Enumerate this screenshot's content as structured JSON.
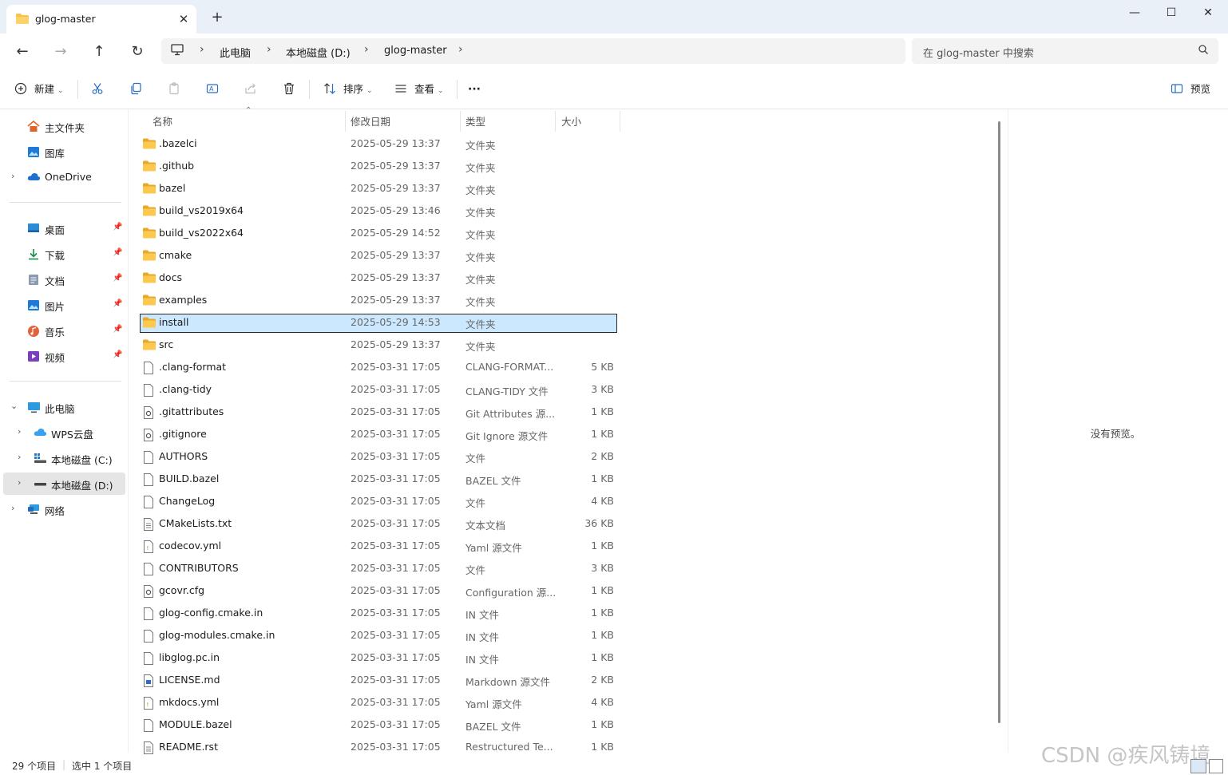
{
  "window": {
    "tab_title": "glog-master",
    "tab_close": "✕",
    "new_tab": "+",
    "minimize": "—",
    "maximize": "☐",
    "close": "✕"
  },
  "nav": {
    "back": "←",
    "forward": "→",
    "up": "↑",
    "refresh": "↻",
    "breadcrumb": [
      "此电脑",
      "本地磁盘 (D:)",
      "glog-master"
    ],
    "search_placeholder": "在 glog-master 中搜索"
  },
  "toolbar": {
    "new_label": "新建",
    "sort_label": "排序",
    "view_label": "查看",
    "more_label": "···",
    "preview_label": "预览"
  },
  "sidebar": {
    "items": [
      {
        "label": "主文件夹",
        "icon": "home-icon"
      },
      {
        "label": "图库",
        "icon": "gallery-icon"
      },
      {
        "label": "OneDrive",
        "icon": "cloud-icon"
      },
      {
        "label": "桌面",
        "icon": "desktop-icon"
      },
      {
        "label": "下载",
        "icon": "download-icon"
      },
      {
        "label": "文档",
        "icon": "document-icon"
      },
      {
        "label": "图片",
        "icon": "pictures-icon"
      },
      {
        "label": "音乐",
        "icon": "music-icon"
      },
      {
        "label": "视频",
        "icon": "video-icon"
      },
      {
        "label": "此电脑",
        "icon": "computer-icon"
      },
      {
        "label": "WPS云盘",
        "icon": "wps-cloud-icon"
      },
      {
        "label": "本地磁盘 (C:)",
        "icon": "drive-icon"
      },
      {
        "label": "本地磁盘 (D:)",
        "icon": "drive-icon"
      },
      {
        "label": "网络",
        "icon": "network-icon"
      }
    ]
  },
  "columns": {
    "name": "名称",
    "date": "修改日期",
    "type": "类型",
    "size": "大小"
  },
  "files": [
    {
      "name": ".bazelci",
      "date": "2025-05-29 13:37",
      "type": "文件夹",
      "size": "",
      "kind": "folder"
    },
    {
      "name": ".github",
      "date": "2025-05-29 13:37",
      "type": "文件夹",
      "size": "",
      "kind": "folder"
    },
    {
      "name": "bazel",
      "date": "2025-05-29 13:37",
      "type": "文件夹",
      "size": "",
      "kind": "folder"
    },
    {
      "name": "build_vs2019x64",
      "date": "2025-05-29 13:46",
      "type": "文件夹",
      "size": "",
      "kind": "folder"
    },
    {
      "name": "build_vs2022x64",
      "date": "2025-05-29 14:52",
      "type": "文件夹",
      "size": "",
      "kind": "folder"
    },
    {
      "name": "cmake",
      "date": "2025-05-29 13:37",
      "type": "文件夹",
      "size": "",
      "kind": "folder"
    },
    {
      "name": "docs",
      "date": "2025-05-29 13:37",
      "type": "文件夹",
      "size": "",
      "kind": "folder"
    },
    {
      "name": "examples",
      "date": "2025-05-29 13:37",
      "type": "文件夹",
      "size": "",
      "kind": "folder"
    },
    {
      "name": "install",
      "date": "2025-05-29 14:53",
      "type": "文件夹",
      "size": "",
      "kind": "folder",
      "selected": true
    },
    {
      "name": "src",
      "date": "2025-05-29 13:37",
      "type": "文件夹",
      "size": "",
      "kind": "folder"
    },
    {
      "name": ".clang-format",
      "date": "2025-03-31 17:05",
      "type": "CLANG-FORMAT...",
      "size": "5 KB",
      "kind": "file"
    },
    {
      "name": ".clang-tidy",
      "date": "2025-03-31 17:05",
      "type": "CLANG-TIDY 文件",
      "size": "3 KB",
      "kind": "file"
    },
    {
      "name": ".gitattributes",
      "date": "2025-03-31 17:05",
      "type": "Git Attributes 源...",
      "size": "1 KB",
      "kind": "config"
    },
    {
      "name": ".gitignore",
      "date": "2025-03-31 17:05",
      "type": "Git Ignore 源文件",
      "size": "1 KB",
      "kind": "config"
    },
    {
      "name": "AUTHORS",
      "date": "2025-03-31 17:05",
      "type": "文件",
      "size": "2 KB",
      "kind": "file"
    },
    {
      "name": "BUILD.bazel",
      "date": "2025-03-31 17:05",
      "type": "BAZEL 文件",
      "size": "1 KB",
      "kind": "file"
    },
    {
      "name": "ChangeLog",
      "date": "2025-03-31 17:05",
      "type": "文件",
      "size": "4 KB",
      "kind": "file"
    },
    {
      "name": "CMakeLists.txt",
      "date": "2025-03-31 17:05",
      "type": "文本文档",
      "size": "36 KB",
      "kind": "text"
    },
    {
      "name": "codecov.yml",
      "date": "2025-03-31 17:05",
      "type": "Yaml 源文件",
      "size": "1 KB",
      "kind": "yaml"
    },
    {
      "name": "CONTRIBUTORS",
      "date": "2025-03-31 17:05",
      "type": "文件",
      "size": "3 KB",
      "kind": "file"
    },
    {
      "name": "gcovr.cfg",
      "date": "2025-03-31 17:05",
      "type": "Configuration 源...",
      "size": "1 KB",
      "kind": "config"
    },
    {
      "name": "glog-config.cmake.in",
      "date": "2025-03-31 17:05",
      "type": "IN 文件",
      "size": "1 KB",
      "kind": "file"
    },
    {
      "name": "glog-modules.cmake.in",
      "date": "2025-03-31 17:05",
      "type": "IN 文件",
      "size": "1 KB",
      "kind": "file"
    },
    {
      "name": "libglog.pc.in",
      "date": "2025-03-31 17:05",
      "type": "IN 文件",
      "size": "1 KB",
      "kind": "file"
    },
    {
      "name": "LICENSE.md",
      "date": "2025-03-31 17:05",
      "type": "Markdown 源文件",
      "size": "2 KB",
      "kind": "markdown"
    },
    {
      "name": "mkdocs.yml",
      "date": "2025-03-31 17:05",
      "type": "Yaml 源文件",
      "size": "4 KB",
      "kind": "yaml"
    },
    {
      "name": "MODULE.bazel",
      "date": "2025-03-31 17:05",
      "type": "BAZEL 文件",
      "size": "1 KB",
      "kind": "file"
    },
    {
      "name": "README.rst",
      "date": "2025-03-31 17:05",
      "type": "Restructured Te...",
      "size": "1 KB",
      "kind": "text"
    }
  ],
  "preview_pane": {
    "empty_text": "没有预览。"
  },
  "status": {
    "item_count": "29 个项目",
    "selected_count": "选中 1 个项目"
  },
  "watermark": "CSDN @疾风铸境",
  "colors": {
    "folder": "#f8c14a",
    "folder_dark": "#e8a92a",
    "selection": "#cce8ff",
    "titlebar": "#eaf0f7"
  }
}
